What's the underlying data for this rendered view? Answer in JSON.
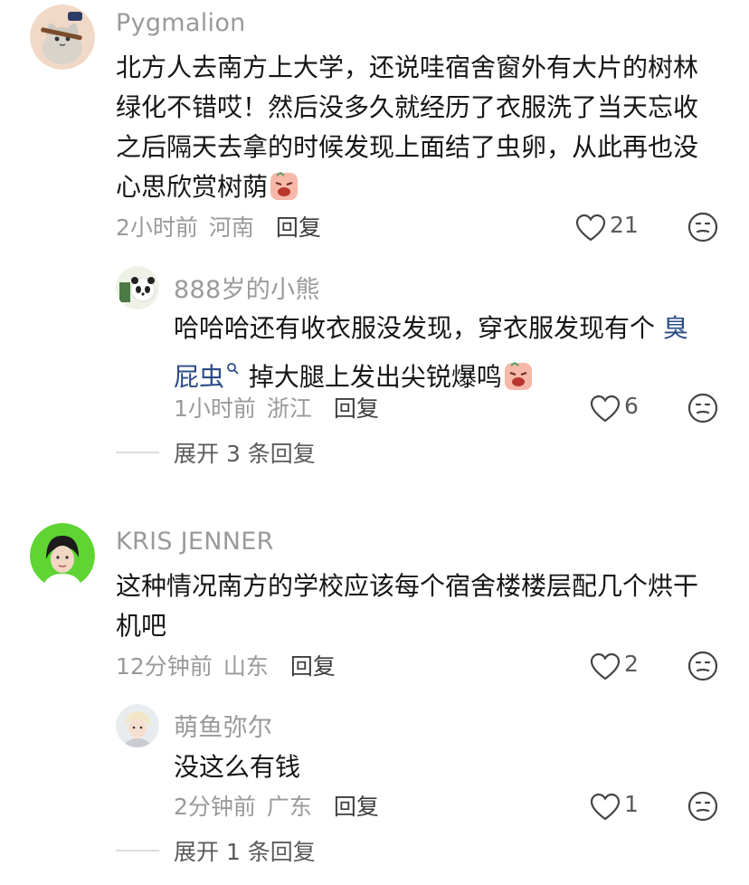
{
  "comments": [
    {
      "username": "Pygmalion",
      "text_parts": [
        "北方人去南方上大学，还说哇宿舍窗外有大片的树林",
        "绿化不错哎！然后没多久就经历了衣服洗了当天忘收",
        "之后隔天去拿的时候发现上面结了虫卵，从此再也没",
        "心思欣赏树荫"
      ],
      "time": "2小时前",
      "location": "河南",
      "reply_label": "回复",
      "likes": "21",
      "avatar_icon": "cat-avatar-icon",
      "emoji_icon": "crying-face-emoji-icon"
    },
    {
      "username": "888岁的小熊",
      "text_before": "哈哈哈还有收衣服没发现，穿衣服发现有个",
      "link_word": "臭",
      "link_word_2": "屁虫",
      "text_after": "掉大腿上发出尖锐爆鸣",
      "time": "1小时前",
      "location": "浙江",
      "reply_label": "回复",
      "likes": "6",
      "avatar_icon": "panda-avatar-icon",
      "emoji_icon": "crying-face-emoji-icon",
      "search_icon": "search-icon"
    },
    {
      "expand_label": "展开 3 条回复"
    },
    {
      "username": "KRIS JENNER",
      "text_parts": [
        "这种情况南方的学校应该每个宿舍楼楼层配几个烘干",
        "机吧"
      ],
      "time": "12分钟前",
      "location": "山东",
      "reply_label": "回复",
      "likes": "2",
      "avatar_icon": "person-avatar-icon"
    },
    {
      "username": "萌鱼弥尔",
      "text": "没这么有钱",
      "time": "2分钟前",
      "location": "广东",
      "reply_label": "回复",
      "likes": "1",
      "avatar_icon": "person-avatar-icon"
    },
    {
      "expand_label": "展开 1 条回复"
    }
  ],
  "colors": {
    "username": "#9a9a9a",
    "text": "#161616",
    "link": "#2b4c86",
    "meta": "#9a9a9a"
  }
}
